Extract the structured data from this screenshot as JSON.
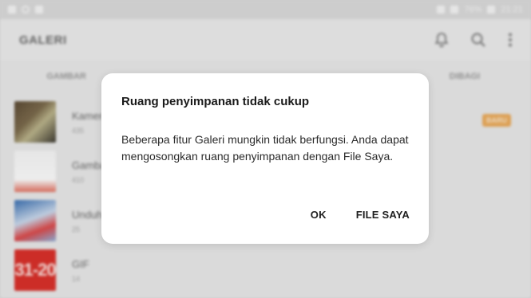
{
  "status_bar": {
    "battery": "76%",
    "time": "21:21"
  },
  "app_bar": {
    "title": "GALERI",
    "icons": [
      "bell-icon",
      "search-icon",
      "more-vertical-icon"
    ]
  },
  "tabs": [
    {
      "label": "GAMBAR"
    },
    {
      "label": ""
    },
    {
      "label": ""
    },
    {
      "label": "DIBAGI"
    }
  ],
  "albums": [
    {
      "name": "Kamera",
      "count": "435"
    },
    {
      "name": "Gambar",
      "count": "410"
    },
    {
      "name": "Unduhan",
      "count": "25"
    },
    {
      "name": "GIF",
      "count": "14",
      "thumb_text": "31-20"
    }
  ],
  "badge": {
    "label": "BARU"
  },
  "dialog": {
    "title": "Ruang penyimpanan tidak cukup",
    "body": "Beberapa fitur Galeri mungkin tidak berfungsi. Anda dapat mengosongkan ruang penyimpanan dengan File Saya.",
    "ok_label": "OK",
    "file_label": "FILE SAYA"
  },
  "colors": {
    "dialog_background": "#ffffff",
    "badge": "#e8a95a",
    "gif_thumb": "#d7302a"
  }
}
